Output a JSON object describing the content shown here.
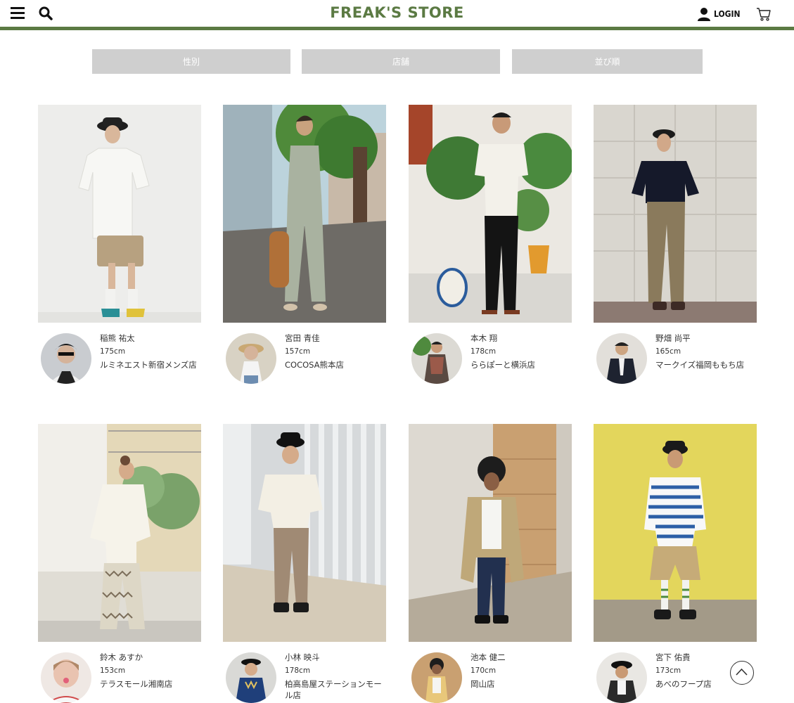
{
  "header": {
    "logo": "FREAK'S STORE",
    "login_label": "LOGIN",
    "brand_color": "#5b7a43",
    "icons": [
      "hamburger-menu-icon",
      "search-icon",
      "user-icon",
      "cart-icon"
    ]
  },
  "filters": [
    {
      "label": "性別"
    },
    {
      "label": "店舗"
    },
    {
      "label": "並び順"
    }
  ],
  "posts": [
    {
      "name": "稲熊 祐太",
      "height": "175cm",
      "store": "ルミネエスト新宿メンズ店",
      "outfit": "white short-sleeve shirt, beige cargo shorts, bucket hat, sandals",
      "bg": "#ececea"
    },
    {
      "name": "宮田 青佳",
      "height": "157cm",
      "store": "COCOSA熊本店",
      "outfit": "sage sleeveless top and wide pants, mesh bag, street with trees",
      "bg": "#8d9a86"
    },
    {
      "name": "本木 翔",
      "height": "178cm",
      "store": "ららぽーと横浜店",
      "outfit": "white shirt, black trousers, sandals, plants",
      "bg": "#e9e6df"
    },
    {
      "name": "野畑 尚平",
      "height": "165cm",
      "store": "マークイズ福岡ももち店",
      "outfit": "black tee, brown wide trousers, cap, concrete wall",
      "bg": "#d8d4cd"
    },
    {
      "name": "鈴木 あすか",
      "height": "153cm",
      "store": "テラスモール湘南店",
      "outfit": "white oversized shirt, floral wide pants",
      "bg": "#eeece6"
    },
    {
      "name": "小林 映斗",
      "height": "178cm",
      "store": "柏高島屋ステーションモール店",
      "outfit": "white shirt, brown trousers, black bucket hat",
      "bg": "#cfd3d6"
    },
    {
      "name": "池本 健二",
      "height": "170cm",
      "store": "岡山店",
      "outfit": "khaki parka, white tee, indigo jeans, wood wall",
      "bg": "#cfa77a"
    },
    {
      "name": "宮下 佑貴",
      "height": "173cm",
      "store": "あべのフープ店",
      "outfit": "blue-white striped tee, beige shorts, yellow wall",
      "bg": "#e3d75e"
    }
  ]
}
